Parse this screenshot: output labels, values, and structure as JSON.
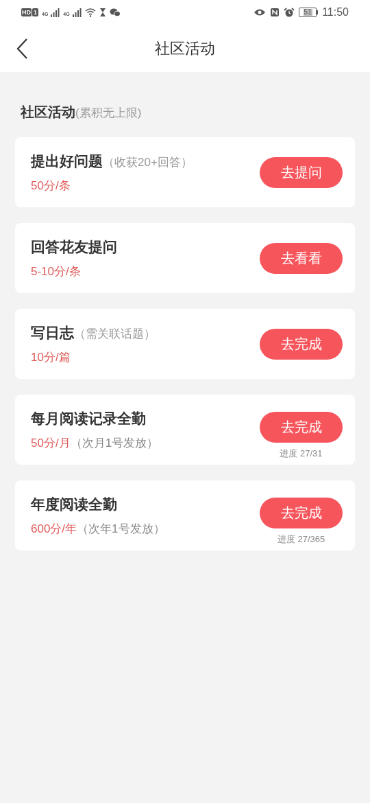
{
  "status_bar": {
    "hd": "HD",
    "sim": "1",
    "net_1": "4G",
    "net_2": "4G",
    "battery": "51",
    "time": "11:50"
  },
  "nav": {
    "title": "社区活动"
  },
  "section": {
    "title": "社区活动",
    "note": "(累积无上限)"
  },
  "tasks": [
    {
      "title": "提出好问题",
      "note": "（收获20+回答）",
      "points": "50分/条",
      "button": "去提问"
    },
    {
      "title": "回答花友提问",
      "points": "5-10分/条",
      "button": "去看看"
    },
    {
      "title": "写日志",
      "note": "（需关联话题）",
      "points": "10分/篇",
      "button": "去完成"
    },
    {
      "title": "每月阅读记录全勤",
      "points": "50分/月",
      "points_note": "（次月1号发放）",
      "button": "去完成",
      "progress": "进度 27/31"
    },
    {
      "title": "年度阅读全勤",
      "points": "600分/年",
      "points_note": "（次年1号发放）",
      "button": "去完成",
      "progress": "进度 27/365"
    }
  ]
}
